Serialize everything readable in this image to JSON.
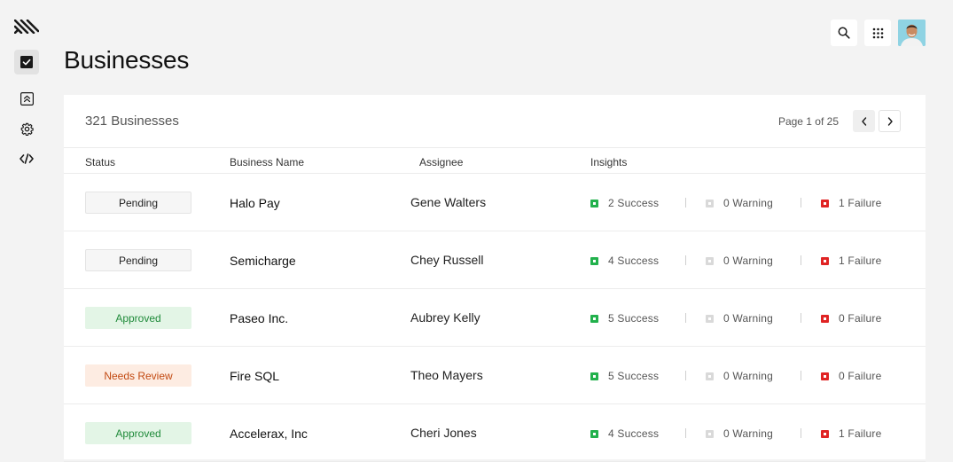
{
  "page": {
    "title": "Businesses"
  },
  "sidebar": {
    "items": [
      {
        "name": "tasks",
        "icon": "checkbox-icon",
        "active": true
      },
      {
        "name": "collapse",
        "icon": "double-chevron-up-icon",
        "active": false
      },
      {
        "name": "settings",
        "icon": "gear-icon",
        "active": false
      },
      {
        "name": "developer",
        "icon": "code-icon",
        "active": false
      }
    ]
  },
  "topbar": {
    "search_icon": "search-icon",
    "apps_icon": "grid-icon",
    "avatar": "user-avatar"
  },
  "table": {
    "count_label": "321 Businesses",
    "page_label": "Page 1 of 25",
    "columns": [
      "Status",
      "Business Name",
      "Assignee",
      "Insights"
    ],
    "rows": [
      {
        "status": "Pending",
        "status_type": "pending",
        "business": "Halo Pay",
        "assignee": "Gene Walters",
        "success": "2 Success",
        "warning": "0 Warning",
        "failure": "1 Failure"
      },
      {
        "status": "Pending",
        "status_type": "pending",
        "business": "Semicharge",
        "assignee": "Chey Russell",
        "success": "4 Success",
        "warning": "0 Warning",
        "failure": "1 Failure"
      },
      {
        "status": "Approved",
        "status_type": "approved",
        "business": "Paseo Inc.",
        "assignee": "Aubrey Kelly",
        "success": "5 Success",
        "warning": "0 Warning",
        "failure": "0 Failure"
      },
      {
        "status": "Needs Review",
        "status_type": "review",
        "business": "Fire SQL",
        "assignee": "Theo Mayers",
        "success": "5 Success",
        "warning": "0 Warning",
        "failure": "0 Failure"
      },
      {
        "status": "Approved",
        "status_type": "approved",
        "business": "Accelerax, Inc",
        "assignee": "Cheri Jones",
        "success": "4 Success",
        "warning": "0 Warning",
        "failure": "1 Failure"
      }
    ]
  },
  "colors": {
    "success": "#22b14c",
    "warning": "#d9d9d9",
    "failure": "#e02424",
    "approved_bg": "#e3f5e6",
    "review_bg": "#fdece2"
  }
}
